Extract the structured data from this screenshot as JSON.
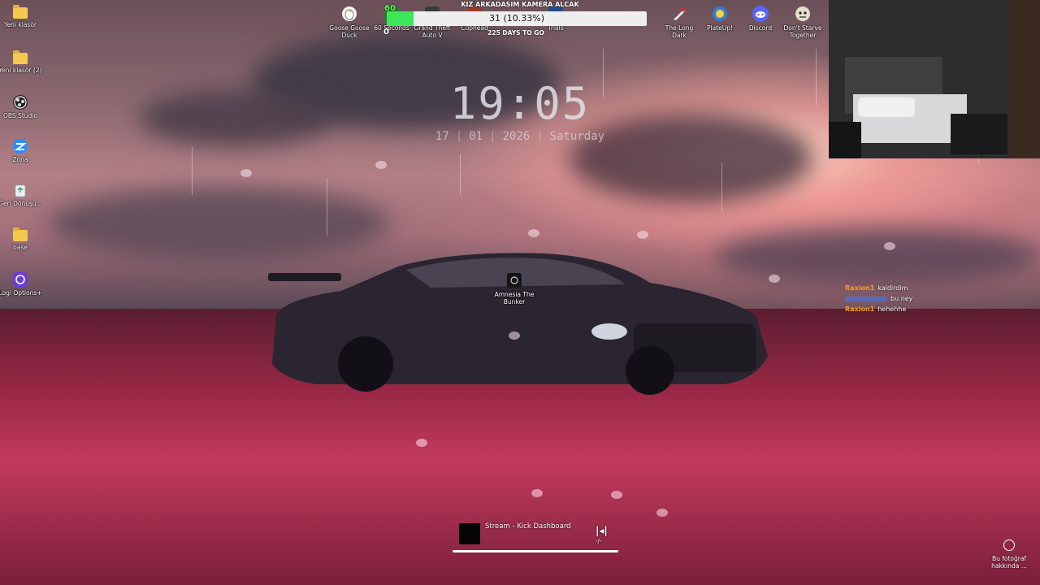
{
  "desktop_icons_left": [
    {
      "label": "Yeni klasör",
      "icon": "folder-icon"
    },
    {
      "label": "Yeni klasör (2)",
      "icon": "folder-icon"
    },
    {
      "label": "OBS Studio",
      "icon": "obs-icon"
    },
    {
      "label": "Zona",
      "icon": "zona-icon"
    },
    {
      "label": "Geri Dönüşü...",
      "icon": "recycle-bin-icon"
    },
    {
      "label": "base",
      "icon": "folder-icon"
    },
    {
      "label": "Logi Options+",
      "icon": "logi-icon"
    }
  ],
  "desktop_icons_top": [
    {
      "label": "Goose Goose Duck",
      "icon": "goose-icon"
    },
    {
      "label": "60 Seconds",
      "icon": "game-icon"
    },
    {
      "label": "Grand Theft Auto V",
      "icon": "game-icon"
    },
    {
      "label": "Cuphead",
      "icon": "game-icon"
    },
    {
      "label": "Trials",
      "icon": "game-icon"
    },
    {
      "label": "The Long Dark",
      "icon": "game-icon"
    },
    {
      "label": "PlateUp!",
      "icon": "plateup-icon"
    },
    {
      "label": "Discord",
      "icon": "discord-icon"
    },
    {
      "label": "Don't Starve Together",
      "icon": "dont-starve-icon"
    }
  ],
  "center_icon": {
    "label": "Amnesia The Bunker",
    "icon": "amnesia-icon"
  },
  "goal": {
    "title": "KIZ ARKADASIM KAMERA ALCAK",
    "text": "31 (10.33%)",
    "progress_percent": 10.33,
    "days": "225 DAYS TO GO",
    "start": "0",
    "badge": "60"
  },
  "clock": {
    "time": "19:05",
    "day": "17",
    "month": "01",
    "year": "2026",
    "weekday": "Saturday"
  },
  "chat": [
    {
      "user": "Raxion1",
      "message": "kaldirdim",
      "color": "#ff9a1a"
    },
    {
      "user": "",
      "message": "bu ney",
      "color": "#3a7bff"
    },
    {
      "user": "Raxion1",
      "message": "hehehhe",
      "color": "#ff9a1a"
    }
  ],
  "media": {
    "title": "Stream - Kick Dashboard",
    "control": "|◂|",
    "control_sub": "-/-"
  },
  "spotlight": {
    "label": "Bu fotoğraf hakkında ..."
  },
  "colors": {
    "goal_fill": "#3ee65a",
    "accent": "#ff4d80"
  }
}
